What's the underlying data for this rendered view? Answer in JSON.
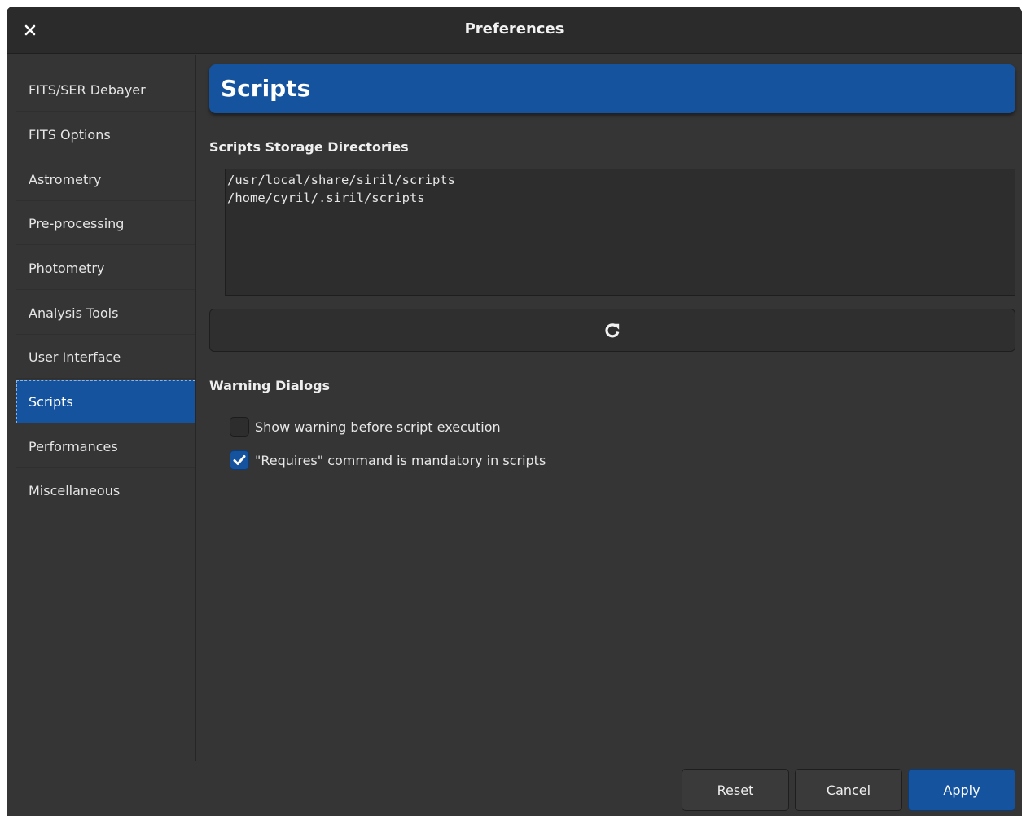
{
  "window": {
    "title": "Preferences"
  },
  "sidebar": {
    "items": [
      {
        "label": "FITS/SER Debayer"
      },
      {
        "label": "FITS Options"
      },
      {
        "label": "Astrometry"
      },
      {
        "label": "Pre-processing"
      },
      {
        "label": "Photometry"
      },
      {
        "label": "Analysis Tools"
      },
      {
        "label": "User Interface"
      },
      {
        "label": "Scripts",
        "selected": true
      },
      {
        "label": "Performances"
      },
      {
        "label": "Miscellaneous"
      }
    ]
  },
  "main": {
    "page_title": "Scripts",
    "directories": {
      "heading": "Scripts Storage Directories",
      "lines": [
        "/usr/local/share/siril/scripts",
        "/home/cyril/.siril/scripts"
      ],
      "refresh_icon": "refresh-icon"
    },
    "warnings": {
      "heading": "Warning Dialogs",
      "options": [
        {
          "label": "Show warning before script execution",
          "checked": false
        },
        {
          "label": "\"Requires\" command is mandatory in scripts",
          "checked": true
        }
      ]
    }
  },
  "footer": {
    "reset_label": "Reset",
    "cancel_label": "Cancel",
    "apply_label": "Apply"
  },
  "colors": {
    "accent": "#15539e",
    "background": "#353535",
    "titlebar": "#2b2b2b"
  }
}
